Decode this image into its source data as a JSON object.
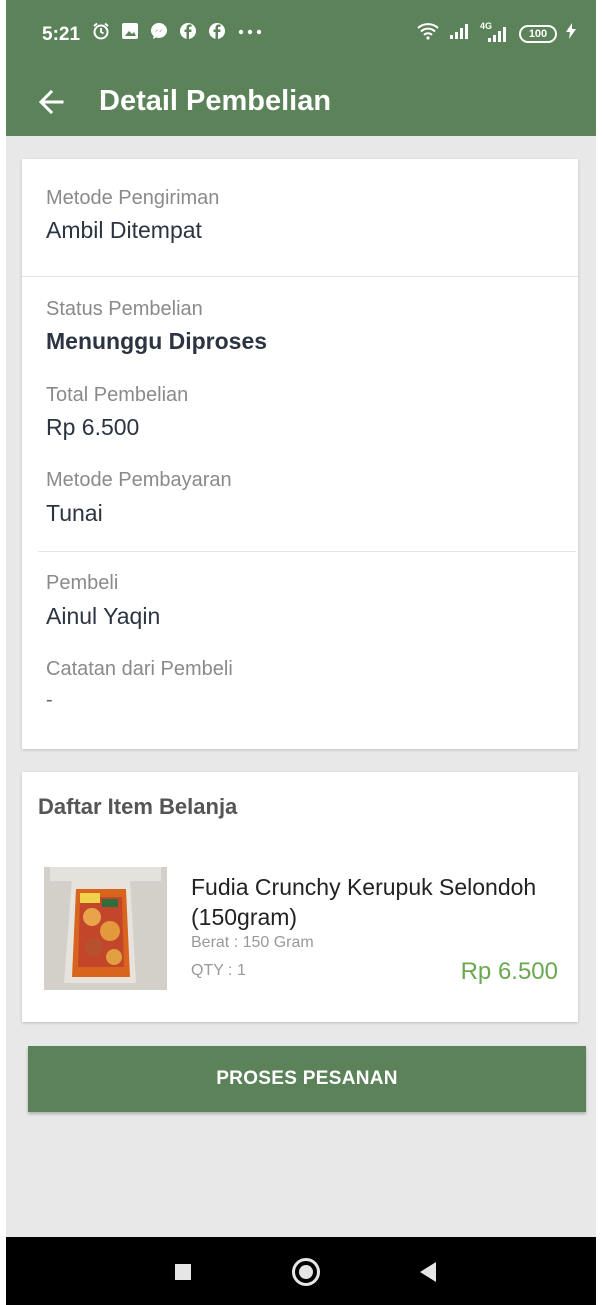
{
  "status_bar": {
    "time": "5:21",
    "left_icons": [
      "alarm-icon",
      "image-icon",
      "messenger-icon",
      "facebook-icon",
      "facebook-icon",
      "more-dots-icon"
    ],
    "network_label": "4G",
    "battery": "100",
    "colors": {
      "bar": "#5b8259"
    }
  },
  "app_bar": {
    "title": "Detail Pembelian",
    "back_icon": "arrow-left-icon"
  },
  "order": {
    "shipping_label": "Metode Pengiriman",
    "shipping_value": "Ambil Ditempat",
    "status_label": "Status Pembelian",
    "status_value": "Menunggu Diproses",
    "total_label": "Total Pembelian",
    "total_value": "Rp 6.500",
    "payment_label": "Metode Pembayaran",
    "payment_value": "Tunai",
    "buyer_label": "Pembeli",
    "buyer_value": "Ainul Yaqin",
    "note_label": "Catatan dari Pembeli",
    "note_value": "-"
  },
  "items": {
    "title": "Daftar Item Belanja",
    "list": [
      {
        "name": "Fudia Crunchy Kerupuk Selondoh (150gram)",
        "weight": "Berat : 150 Gram",
        "qty": "QTY : 1",
        "price": "Rp 6.500"
      }
    ]
  },
  "actions": {
    "process_label": "PROSES PESANAN"
  },
  "nav_bar": {
    "icons": [
      "recent-apps-icon",
      "home-icon",
      "back-icon"
    ]
  },
  "colors": {
    "primary": "#5b8259",
    "price_green": "#6aa84f",
    "background": "#e8e8e8"
  }
}
